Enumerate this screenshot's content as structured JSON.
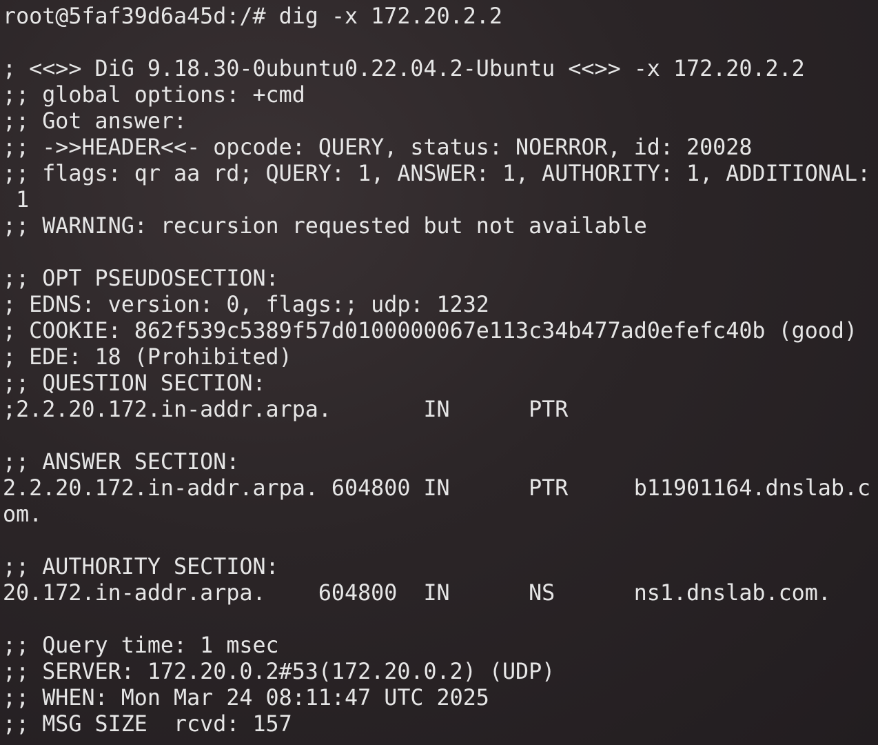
{
  "terminal": {
    "prompt": "root@5faf39d6a45d:/# ",
    "command": "dig -x 172.20.2.2",
    "lines": [
      "",
      "; <<>> DiG 9.18.30-0ubuntu0.22.04.2-Ubuntu <<>> -x 172.20.2.2",
      ";; global options: +cmd",
      ";; Got answer:",
      ";; ->>HEADER<<- opcode: QUERY, status: NOERROR, id: 20028",
      ";; flags: qr aa rd; QUERY: 1, ANSWER: 1, AUTHORITY: 1, ADDITIONAL:",
      " 1",
      ";; WARNING: recursion requested but not available",
      "",
      ";; OPT PSEUDOSECTION:",
      "; EDNS: version: 0, flags:; udp: 1232",
      "; COOKIE: 862f539c5389f57d0100000067e113c34b477ad0efefc40b (good)",
      "; EDE: 18 (Prohibited)",
      ";; QUESTION SECTION:",
      ";2.2.20.172.in-addr.arpa.       IN      PTR",
      "",
      ";; ANSWER SECTION:",
      "2.2.20.172.in-addr.arpa. 604800 IN      PTR     b11901164.dnslab.c",
      "om.",
      "",
      ";; AUTHORITY SECTION:",
      "20.172.in-addr.arpa.    604800  IN      NS      ns1.dnslab.com.",
      "",
      ";; Query time: 1 msec",
      ";; SERVER: 172.20.0.2#53(172.20.0.2) (UDP)",
      ";; WHEN: Mon Mar 24 08:11:47 UTC 2025",
      ";; MSG SIZE  rcvd: 157"
    ]
  }
}
